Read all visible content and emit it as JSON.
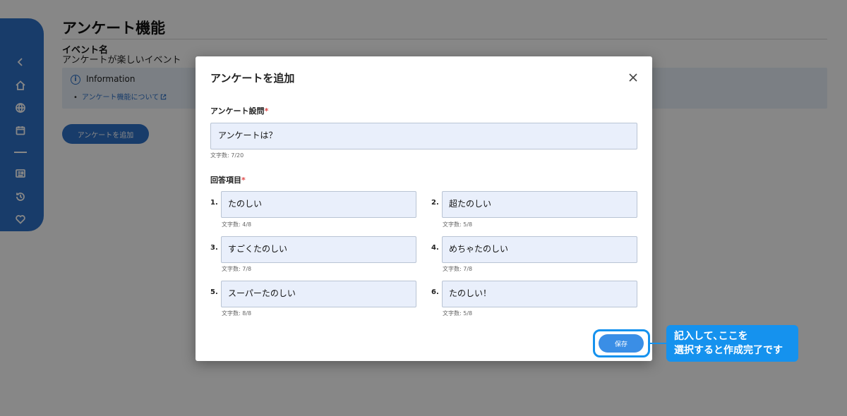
{
  "page": {
    "title": "アンケート機能",
    "event_label": "イベント名",
    "event_value": "アンケートが楽しいイベント",
    "info_title": "Information",
    "info_bullet": "•",
    "info_link": "アンケート機能について",
    "add_button": "アンケートを追加"
  },
  "sidebar": {
    "icons": [
      "chevron-left-icon",
      "home-icon",
      "globe-icon",
      "calendar-icon",
      "news-icon",
      "history-icon",
      "heart-icon"
    ]
  },
  "modal": {
    "title": "アンケートを追加",
    "question_label": "アンケート設問",
    "required_mark": "*",
    "question_value": "アンケートは？",
    "question_count": "文字数: 7/20",
    "answers_label": "回答項目",
    "answers": [
      {
        "num": "1.",
        "value": "たのしい",
        "count": "文字数: 4/8"
      },
      {
        "num": "2.",
        "value": "超たのしい",
        "count": "文字数: 5/8"
      },
      {
        "num": "3.",
        "value": "すごくたのしい",
        "count": "文字数: 7/8"
      },
      {
        "num": "4.",
        "value": "めちゃたのしい",
        "count": "文字数: 7/8"
      },
      {
        "num": "5.",
        "value": "スーパーたのしい",
        "count": "文字数: 8/8"
      },
      {
        "num": "6.",
        "value": "たのしい！",
        "count": "文字数: 5/8"
      }
    ],
    "save_button": "保存"
  },
  "callout": {
    "line1": "記入して､ここを",
    "line2": "選択すると作成完了です"
  },
  "colors": {
    "accent": "#2f72c9",
    "callout": "#1592ee",
    "input_bg": "#e9effb",
    "required": "#e04a4a"
  }
}
